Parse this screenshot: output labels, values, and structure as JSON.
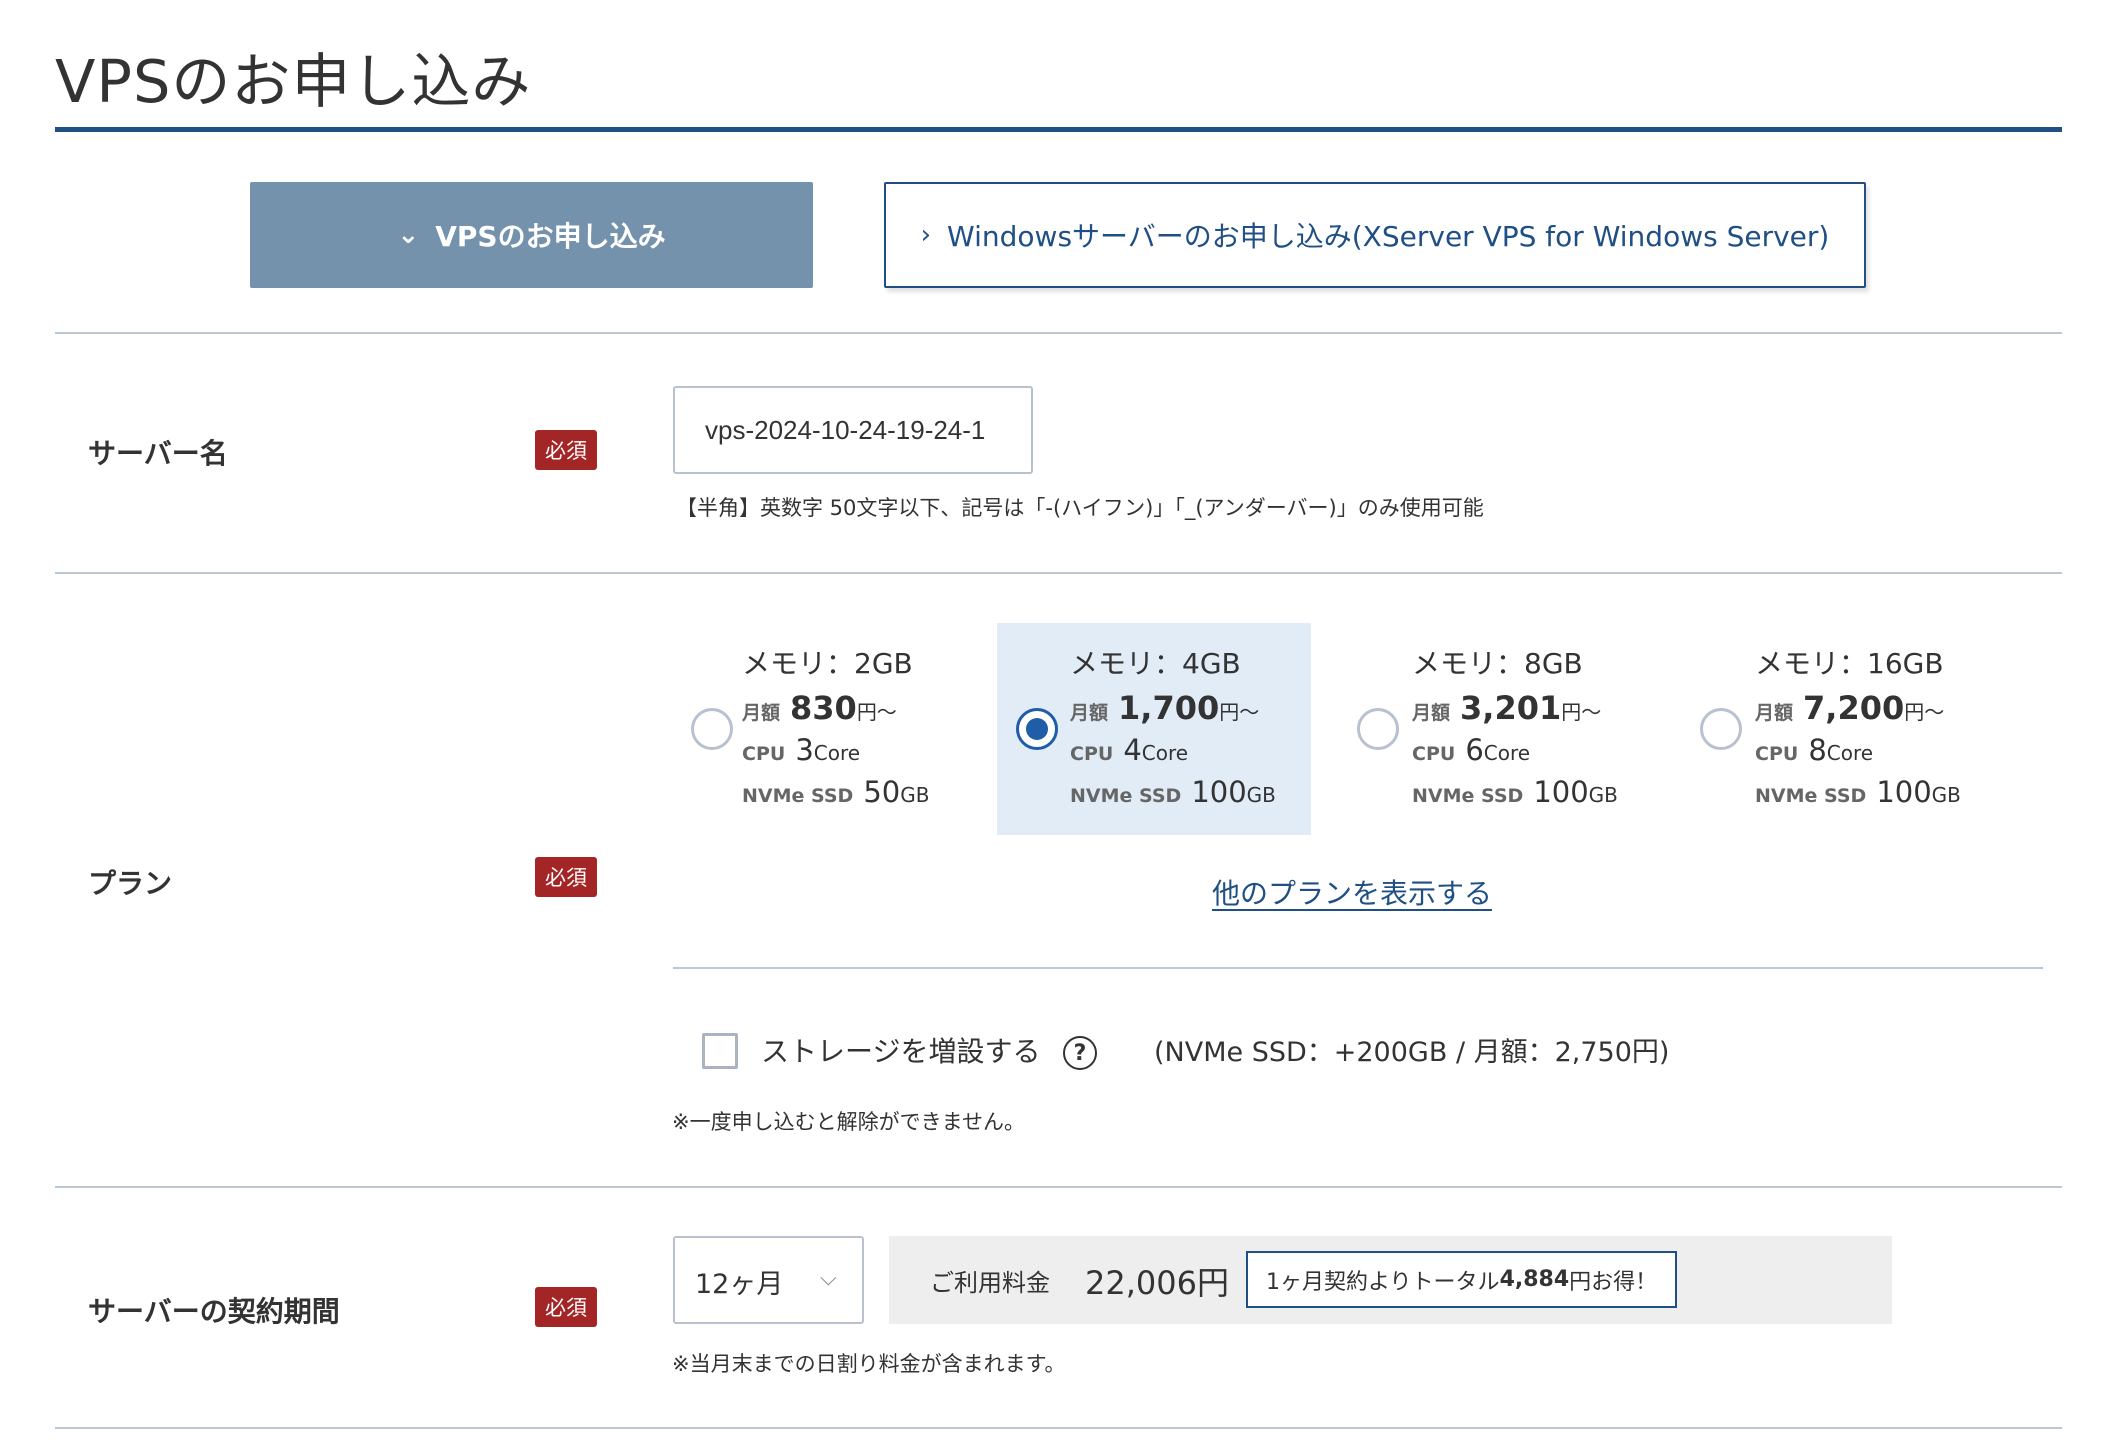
{
  "page": {
    "title": "VPSのお申し込み"
  },
  "tabs": {
    "vps": "VPSのお申し込み",
    "windows": "Windowsサーバーのお申し込み(XServer VPS for Windows Server)"
  },
  "required_badge": "必須",
  "server_name": {
    "label": "サーバー名",
    "value": "vps-2024-10-24-19-24-1",
    "hint": "【半角】英数字 50文字以下、記号は「-(ハイフン)」「_(アンダーバー)」のみ使用可能"
  },
  "plan": {
    "label": "プラン",
    "price_label": "月額",
    "cpu_label": "CPU",
    "ssd_label": "NVMe SSD",
    "yen_unit": "円〜",
    "core_unit": "Core",
    "gb_unit": "GB",
    "options": [
      {
        "memory": "メモリ：2GB",
        "price": "830",
        "cpu": "3",
        "ssd": "50",
        "selected": false
      },
      {
        "memory": "メモリ：4GB",
        "price": "1,700",
        "cpu": "4",
        "ssd": "100",
        "selected": true
      },
      {
        "memory": "メモリ：8GB",
        "price": "3,201",
        "cpu": "6",
        "ssd": "100",
        "selected": false
      },
      {
        "memory": "メモリ：16GB",
        "price": "7,200",
        "cpu": "8",
        "ssd": "100",
        "selected": false
      }
    ],
    "more_link": "他のプランを表示する",
    "storage_label": "ストレージを増設する",
    "help_icon": "?",
    "storage_price": "(NVMe SSD：+200GB / 月額：2,750円)",
    "storage_note": "※一度申し込むと解除ができません。"
  },
  "period": {
    "label": "サーバーの契約期間",
    "value": "12ヶ月",
    "chevron": "⌵",
    "fee_label": "ご利用料金",
    "fee_value": "22,006円",
    "savings_prefix": "1ヶ月契約よりトータル",
    "savings_amount": "4,884",
    "savings_suffix": "円お得！",
    "note": "※当月末までの日割り料金が含まれます。"
  },
  "colors": {
    "brand": "#1f4f84",
    "selected_bg": "#e1ecf7",
    "required": "#a32525",
    "active_tab": "#7592ad"
  }
}
